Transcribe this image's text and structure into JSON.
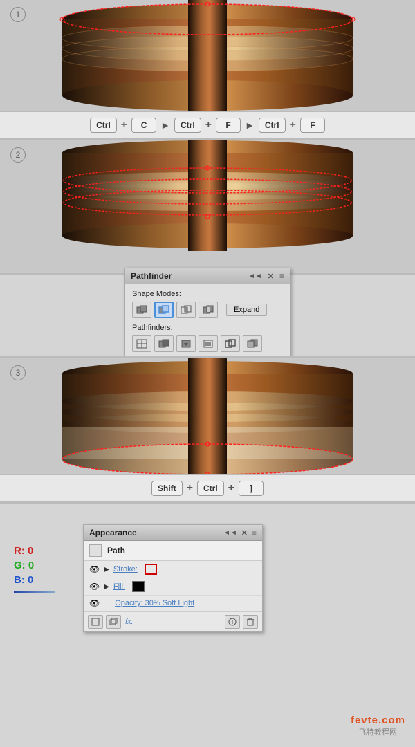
{
  "sections": {
    "s1": {
      "step": "1",
      "kbd": [
        "Ctrl",
        "+",
        "C",
        ">",
        "Ctrl",
        "+",
        "F",
        ">",
        "Ctrl",
        "+",
        "F"
      ]
    },
    "s2": {
      "step": "2"
    },
    "s3": {
      "panel": {
        "title": "Pathfinder",
        "controls_right": "◄◄  ✕",
        "menu_icon": "≡",
        "shape_modes_label": "Shape Modes:",
        "pathfinders_label": "Pathfinders:",
        "expand_label": "Expand"
      }
    },
    "s4": {
      "step": "3",
      "kbd": [
        "Shift",
        "+",
        "Ctrl",
        "+",
        "]"
      ]
    },
    "s5": {
      "rgb": {
        "r": "R: 0",
        "g": "G: 0",
        "b": "B: 0"
      },
      "panel": {
        "title": "Appearance",
        "controls_right": "◄◄  ✕",
        "menu_icon": "≡",
        "path_label": "Path",
        "stroke_label": "Stroke:",
        "fill_label": "Fill:",
        "opacity_label": "Opacity: 30% Soft Light",
        "fx_label": "fx."
      },
      "watermark_line1": "fevte.com",
      "watermark_line2": "飞特教程网"
    }
  }
}
